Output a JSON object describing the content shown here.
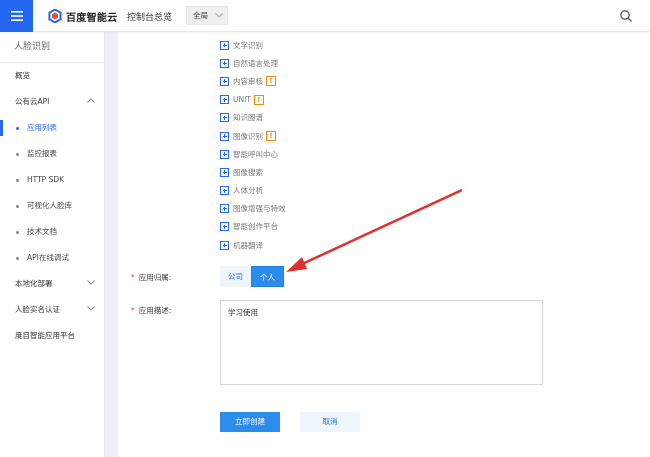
{
  "header": {
    "brand": "百度智能云",
    "console_home": "控制台总览",
    "region": "全局"
  },
  "sidebar": {
    "title": "人脸识别",
    "items": [
      {
        "label": "概览"
      },
      {
        "label": "公有云API"
      },
      {
        "label": "应用列表"
      },
      {
        "label": "监控报表"
      },
      {
        "label": "HTTP SDK"
      },
      {
        "label": "可视化人脸库"
      },
      {
        "label": "技术文档"
      },
      {
        "label": "API在线调试"
      },
      {
        "label": "本地化部署"
      },
      {
        "label": "人脸实名认证"
      },
      {
        "label": "度目智能应用平台"
      }
    ]
  },
  "services": [
    {
      "label": "文字识别",
      "warning": ""
    },
    {
      "label": "自然语言处理",
      "warning": ""
    },
    {
      "label": "内容审核",
      "warning": "!"
    },
    {
      "label": "UNIT",
      "warning": "!"
    },
    {
      "label": "知识图谱",
      "warning": ""
    },
    {
      "label": "图像识别",
      "warning": "!"
    },
    {
      "label": "智能呼叫中心",
      "warning": ""
    },
    {
      "label": "图像搜索",
      "warning": ""
    },
    {
      "label": "人体分析",
      "warning": ""
    },
    {
      "label": "图像增强与特效",
      "warning": ""
    },
    {
      "label": "智能创作平台",
      "warning": ""
    },
    {
      "label": "机器翻译",
      "warning": ""
    }
  ],
  "form": {
    "required_mark": "*",
    "owner_label": "应用归属:",
    "owner_options": [
      "公司",
      "个人"
    ],
    "owner_selected": "个人",
    "desc_label": "应用描述:",
    "desc_value": "学习使用",
    "create_label": "立即创建",
    "cancel_label": "取消"
  },
  "colors": {
    "accent": "#2468f2",
    "warning": "#f38900",
    "annotation_arrow": "#e0302b"
  }
}
